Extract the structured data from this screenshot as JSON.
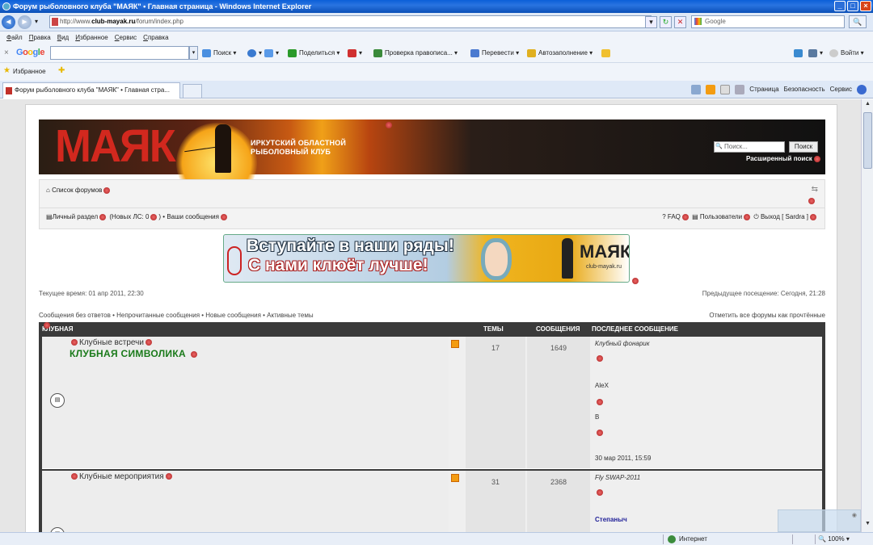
{
  "window": {
    "title": "Форум рыболовного клуба \"МАЯК\" • Главная страница - Windows Internet Explorer"
  },
  "address": {
    "url_prefix": "http://www.",
    "url_domain": "club-mayak.ru",
    "url_path": "/forum/index.php",
    "search_placeholder": "Google"
  },
  "menu": [
    "Файл",
    "Правка",
    "Вид",
    "Избранное",
    "Сервис",
    "Справка"
  ],
  "google_toolbar": {
    "logo": "Google",
    "buttons": [
      "Поиск",
      "Поделиться",
      "Проверка правописа...",
      "Перевести",
      "Автозаполнение"
    ],
    "right": "Войти"
  },
  "favorites": {
    "label": "Избранное"
  },
  "tab": {
    "title": "Форум рыболовного клуба \"МАЯК\" • Главная стра..."
  },
  "command_bar": [
    "Страница",
    "Безопасность",
    "Сервис"
  ],
  "forum_header": {
    "logo": "МАЯК",
    "club_name_line1": "ИРКУТСКИЙ ОБЛАСТНОЙ",
    "club_name_line2": "РЫБОЛОВНЫЙ КЛУБ",
    "search_placeholder": "Поиск...",
    "search_button": "Поиск",
    "advanced_search": "Расширенный поиск"
  },
  "nav": {
    "forum_index": "Список форумов",
    "user_cp": "Личный раздел",
    "new_pm": "(Новых ЛС: 0",
    "your_posts": "Ваши сообщения",
    "faq": "FAQ",
    "members": "Пользователи",
    "logout": "Выход [ Sardra ]"
  },
  "banner": {
    "line1": "Вступайте в наши ряды!",
    "line2": "С нами клюёт лучше!",
    "logo": "МАЯК",
    "site": "club-mayak.ru"
  },
  "info": {
    "current_time": "Текущее время: 01 апр 2011, 22:30",
    "last_visit": "Предыдущее посещение: Сегодня, 21:28",
    "links": "Сообщения без ответов • Непрочитанные сообщения • Новые сообщения • Активные темы",
    "mark_read": "Отметить все форумы как прочтённые"
  },
  "table": {
    "category": "КЛУБНАЯ ЖИЗНЬ",
    "col_topics": "ТЕМЫ",
    "col_posts": "СООБЩЕНИЯ",
    "col_last": "ПОСЛЕДНЕЕ СООБЩЕНИЕ",
    "rows": [
      {
        "title": "Клубные встречи",
        "subtitle": "КЛУБНАЯ СИМВОЛИКА",
        "topics": "17",
        "posts": "1649",
        "last_topic": "Клубный фонарик",
        "last_user": "AleX",
        "last_extra": "В",
        "last_date": "30 мар 2011, 15:59"
      },
      {
        "title": "Клубные мероприятия",
        "subtitle": "",
        "topics": "31",
        "posts": "2368",
        "last_topic": "Fly SWAP-2011",
        "last_user": "Степаныч"
      }
    ]
  },
  "status": {
    "zone": "Интернет",
    "zoom": "100%"
  }
}
